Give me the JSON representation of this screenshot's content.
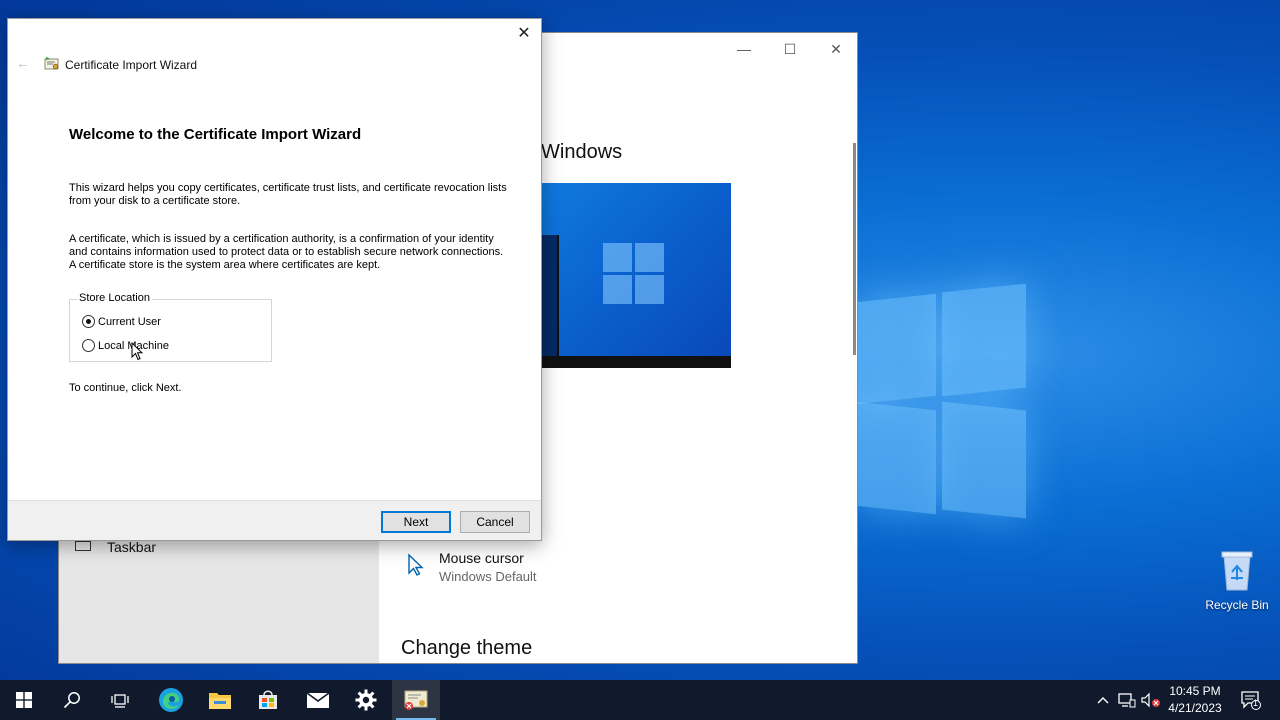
{
  "desktop": {
    "recycle_bin_label": "Recycle Bin"
  },
  "settings": {
    "section_heading": "Windows",
    "taskbar_label": "Taskbar",
    "cursor_title": "Mouse cursor",
    "cursor_value": "Windows Default",
    "change_theme": "Change theme",
    "minimize_glyph": "—",
    "maximize_glyph": "☐",
    "close_glyph": "✕"
  },
  "wizard": {
    "window_title": "Certificate Import Wizard",
    "back_glyph": "←",
    "close_glyph": "✕",
    "heading": "Welcome to the Certificate Import Wizard",
    "paragraph1": "This wizard helps you copy certificates, certificate trust lists, and certificate revocation lists from your disk to a certificate store.",
    "paragraph2": "A certificate, which is issued by a certification authority, is a confirmation of your identity and contains information used to protect data or to establish secure network connections. A certificate store is the system area where certificates are kept.",
    "store_location": {
      "legend": "Store Location",
      "options": [
        {
          "label": "Current User",
          "selected": true
        },
        {
          "label": "Local Machine",
          "selected": false
        }
      ]
    },
    "continue_text": "To continue, click Next.",
    "next_label": "Next",
    "cancel_label": "Cancel"
  },
  "taskbar": {
    "icons": [
      "windows-start-icon",
      "search-icon",
      "task-view-icon",
      "edge-icon",
      "file-explorer-icon",
      "store-icon",
      "mail-icon",
      "settings-icon",
      "certificate-wizard-icon"
    ],
    "clock_time": "10:45 PM",
    "clock_date": "4/21/2023",
    "notification_count": "1"
  },
  "colors": {
    "accent": "#0078d7",
    "taskbar": "#101a2c",
    "desktop": "#0a6fd4"
  }
}
